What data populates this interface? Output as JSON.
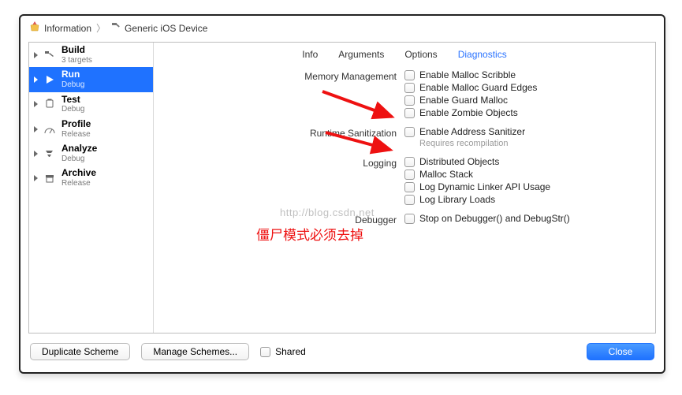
{
  "breadcrumb": {
    "root": "Information",
    "target": "Generic iOS Device"
  },
  "sidebar": {
    "items": [
      {
        "title": "Build",
        "sub": "3 targets"
      },
      {
        "title": "Run",
        "sub": "Debug"
      },
      {
        "title": "Test",
        "sub": "Debug"
      },
      {
        "title": "Profile",
        "sub": "Release"
      },
      {
        "title": "Analyze",
        "sub": "Debug"
      },
      {
        "title": "Archive",
        "sub": "Release"
      }
    ]
  },
  "tabs": {
    "info": "Info",
    "arguments": "Arguments",
    "options": "Options",
    "diagnostics": "Diagnostics"
  },
  "sections": {
    "memory": {
      "label": "Memory Management",
      "opts": {
        "scribble": "Enable Malloc Scribble",
        "guard_edges": "Enable Malloc Guard Edges",
        "guard_malloc": "Enable Guard Malloc",
        "zombie": "Enable Zombie Objects"
      }
    },
    "sanitize": {
      "label": "Runtime Sanitization",
      "opts": {
        "asan": "Enable Address Sanitizer",
        "asan_hint": "Requires recompilation"
      }
    },
    "logging": {
      "label": "Logging",
      "opts": {
        "distributed": "Distributed Objects",
        "malloc_stack": "Malloc Stack",
        "dyld": "Log Dynamic Linker API Usage",
        "library": "Log Library Loads"
      }
    },
    "debugger": {
      "label": "Debugger",
      "opts": {
        "stop": "Stop on Debugger() and DebugStr()"
      }
    }
  },
  "annotation": {
    "text": "僵尸模式必须去掉",
    "watermark": "http://blog.csdn.net"
  },
  "footer": {
    "duplicate": "Duplicate Scheme",
    "manage": "Manage Schemes...",
    "shared": "Shared",
    "close": "Close"
  }
}
